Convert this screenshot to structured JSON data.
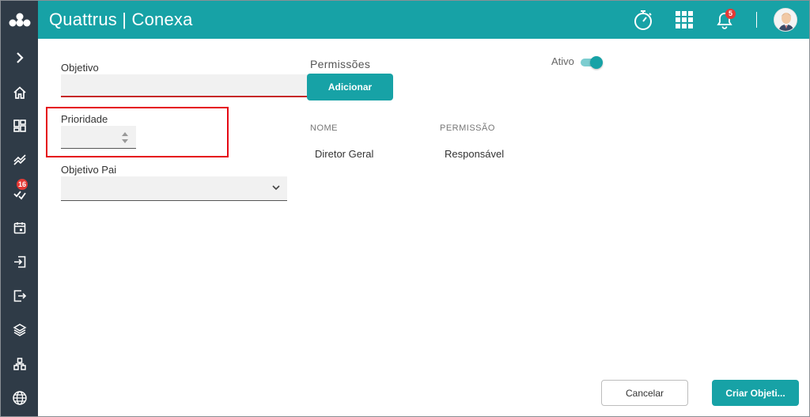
{
  "header": {
    "title": "Quattrus | Conexa",
    "notification_count": "5",
    "colors": {
      "primary": "#17a2a6",
      "sidebar": "#2f3b47",
      "error": "#c62828"
    }
  },
  "sidebar": {
    "items": [
      {
        "icon": "chevron-right-icon"
      },
      {
        "icon": "home-icon"
      },
      {
        "icon": "dashboard-icon"
      },
      {
        "icon": "trend-icon"
      },
      {
        "icon": "tasks-icon",
        "badge": "16"
      },
      {
        "icon": "calendar-icon"
      },
      {
        "icon": "login-icon"
      },
      {
        "icon": "logout-icon"
      },
      {
        "icon": "layers-icon"
      },
      {
        "icon": "hierarchy-icon"
      },
      {
        "icon": "globe-icon"
      }
    ]
  },
  "form": {
    "objective_label": "Objetivo",
    "objective_value": "",
    "priority_label": "Prioridade",
    "priority_value": "",
    "parent_label": "Objetivo Pai",
    "parent_value": ""
  },
  "permissions": {
    "title": "Permissões",
    "add_button": "Adicionar",
    "columns": [
      "NOME",
      "PERMISSÃO"
    ],
    "rows": [
      {
        "name": "Diretor Geral",
        "permission": "Responsável"
      }
    ]
  },
  "status": {
    "label": "Ativo",
    "active": true
  },
  "actions": {
    "cancel": "Cancelar",
    "create": "Criar Objeti..."
  }
}
